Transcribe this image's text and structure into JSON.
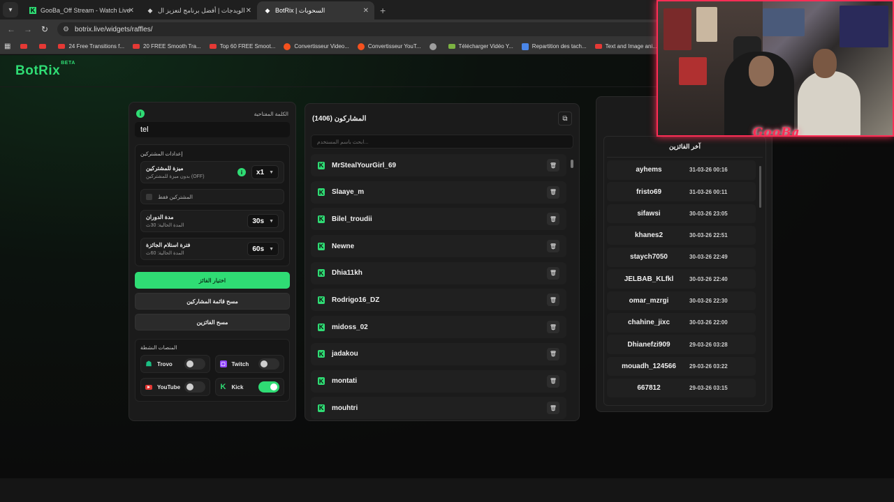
{
  "browser": {
    "tabs": [
      {
        "title": "GooBa_Off Stream - Watch Live",
        "active": false
      },
      {
        "title": "الويدجات | أفضل برنامج لتعزيز ال",
        "active": false
      },
      {
        "title": "BotRix | السحوبات",
        "active": true
      }
    ],
    "url": "botrix.live/widgets/raffles/",
    "bookmarks": [
      {
        "label": "",
        "icon": "youtube"
      },
      {
        "label": "",
        "icon": "youtube"
      },
      {
        "label": "24 Free Transitions f...",
        "icon": "youtube"
      },
      {
        "label": "20 FREE Smooth Tra...",
        "icon": "youtube"
      },
      {
        "label": "Top 60 FREE Smoot...",
        "icon": "youtube"
      },
      {
        "label": "Convertisseur Video...",
        "icon": "orange"
      },
      {
        "label": "Convertisseur YouT...",
        "icon": "orange"
      },
      {
        "label": "",
        "icon": "grey"
      },
      {
        "label": "Télécharger Vidéo Y...",
        "icon": "green"
      },
      {
        "label": "Repartition des tach...",
        "icon": "blue"
      },
      {
        "label": "Text and Image ani...",
        "icon": "youtube"
      }
    ]
  },
  "app": {
    "logo": "BotRix",
    "logo_badge": "BETA"
  },
  "settings": {
    "keyword_label": "الكلمة المفتاحية",
    "keyword_value": "tel",
    "subscriber_settings_title": "إعدادات المشتركين",
    "sub_feature_title": "ميزة للمشتركين",
    "sub_feature_desc": "بدون ميزة للمشتركين (OFF)",
    "multiplier": "x1",
    "subs_only_label": "المشتركين فقط",
    "spin_duration_title": "مدة الدوران",
    "spin_duration_desc": "المدة الحالية: 30ث",
    "spin_duration_value": "30s",
    "claim_period_title": "فترة استلام الجائزة",
    "claim_period_desc": "المدة الحالية: 60ث",
    "claim_period_value": "60s",
    "pick_winner_button": "اختيار الفائز",
    "clear_participants_button": "مسح قائمة المشاركين",
    "clear_winners_button": "مسح الفائزين",
    "active_platforms_title": "المنصات النشطة",
    "platforms": [
      {
        "name": "Trovo",
        "icon": "trovo-icon",
        "enabled": false,
        "color": "#1bbf83"
      },
      {
        "name": "Twitch",
        "icon": "twitch-icon",
        "enabled": false,
        "color": "#9146ff"
      },
      {
        "name": "YouTube",
        "icon": "youtube-icon",
        "enabled": false,
        "color": "#e53935"
      },
      {
        "name": "Kick",
        "icon": "kick-icon",
        "enabled": true,
        "color": "#2fdc74"
      }
    ]
  },
  "participants": {
    "title": "المشاركون (1406)",
    "search_placeholder": "ابحث باسم المستخدم...",
    "items": [
      "MrStealYourGirl_69",
      "Slaaye_m",
      "Bilel_troudii",
      "Newne",
      "Dhia11kh",
      "Rodrigo16_DZ",
      "midoss_02",
      "jadakou",
      "montati",
      "mouhtri"
    ]
  },
  "winners": {
    "title": "آخر الفائزين",
    "items": [
      {
        "name": "ayhems",
        "date": "31-03-26 00:16"
      },
      {
        "name": "fristo69",
        "date": "31-03-26 00:11"
      },
      {
        "name": "sifawsi",
        "date": "30-03-26 23:05"
      },
      {
        "name": "khanes2",
        "date": "30-03-26 22:51"
      },
      {
        "name": "staych7050",
        "date": "30-03-26 22:49"
      },
      {
        "name": "JELBAB_KLfkl",
        "date": "30-03-26 22:40"
      },
      {
        "name": "omar_mzrgi",
        "date": "30-03-26 22:30"
      },
      {
        "name": "chahine_jixc",
        "date": "30-03-26 22:00"
      },
      {
        "name": "Dhianefzi909",
        "date": "29-03-26 03:28"
      },
      {
        "name": "mouadh_124566",
        "date": "29-03-26 03:22"
      },
      {
        "name": "667812",
        "date": "29-03-26 03:15"
      }
    ]
  },
  "overlay": {
    "streamer_tag": "GooBa"
  },
  "colors": {
    "accent": "#2fdc74",
    "overlay_border": "#ff2d55"
  }
}
